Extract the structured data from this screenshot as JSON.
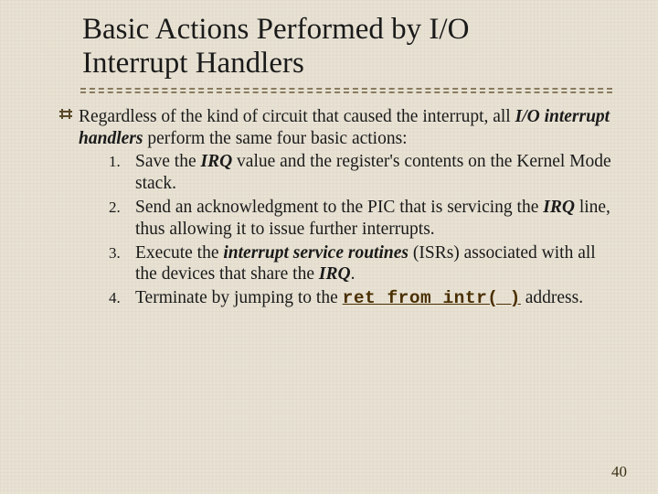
{
  "title_line1": "Basic Actions Performed by I/O",
  "title_line2": "Interrupt Handlers",
  "lead": {
    "pre": "Regardless of the kind of circuit that caused the interrupt, all ",
    "em": "I/O interrupt handlers",
    "post": " perform the same four basic actions:"
  },
  "steps": {
    "s1": {
      "a": "Save the ",
      "irq": "IRQ",
      "b": " value and the register's contents on the Kernel Mode stack."
    },
    "s2": {
      "a": "Send an acknowledgment to the PIC that is servicing the ",
      "irq": "IRQ",
      "b": " line, thus allowing it to issue further interrupts."
    },
    "s3": {
      "a": "Execute the ",
      "isr": "interrupt service routines",
      "b": " (ISRs) associated with all the devices that share the ",
      "irq": "IRQ",
      "c": "."
    },
    "s4": {
      "a": "Terminate by jumping to the ",
      "ret": "ret_from_intr( )",
      "b": " address."
    }
  },
  "page_number": "40"
}
